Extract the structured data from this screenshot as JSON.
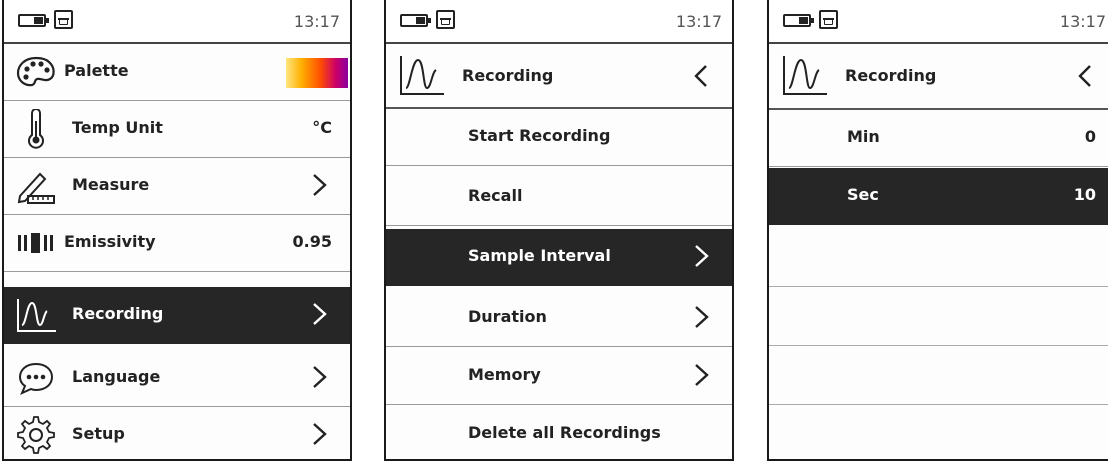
{
  "screens": [
    {
      "status": {
        "time": "13:17"
      },
      "items": [
        {
          "label": "Palette",
          "icon": "palette-icon"
        },
        {
          "label": "Temp Unit",
          "value": "°C",
          "icon": "thermometer-icon"
        },
        {
          "label": "Measure",
          "icon": "ruler-pencil-icon",
          "arrow": ">"
        },
        {
          "label": "Emissivity",
          "value": "0.95",
          "icon": "emissivity-icon"
        },
        {
          "label": "Recording",
          "icon": "recording-wave-icon",
          "arrow": ">",
          "selected": true
        },
        {
          "label": "Language",
          "icon": "speech-bubble-icon",
          "arrow": ">"
        },
        {
          "label": "Setup",
          "icon": "gear-icon",
          "arrow": ">"
        }
      ]
    },
    {
      "status": {
        "time": "13:17"
      },
      "header": {
        "title": "Recording",
        "back": "<"
      },
      "items": [
        {
          "label": "Start Recording"
        },
        {
          "label": "Recall"
        },
        {
          "label": "Sample Interval",
          "arrow": ">",
          "selected": true
        },
        {
          "label": "Duration",
          "arrow": ">"
        },
        {
          "label": "Memory",
          "arrow": ">"
        },
        {
          "label": "Delete all Recordings"
        }
      ]
    },
    {
      "status": {
        "time": "13:17"
      },
      "header": {
        "title": "Recording",
        "back": "<"
      },
      "items": [
        {
          "label": "Min",
          "value": "0"
        },
        {
          "label": "Sec",
          "value": "10",
          "selected": true
        }
      ]
    }
  ],
  "colors": {
    "selected_bg": "#262626",
    "palette_gradient": [
      "#ffe680",
      "#ff5000",
      "#8a00a0"
    ]
  }
}
